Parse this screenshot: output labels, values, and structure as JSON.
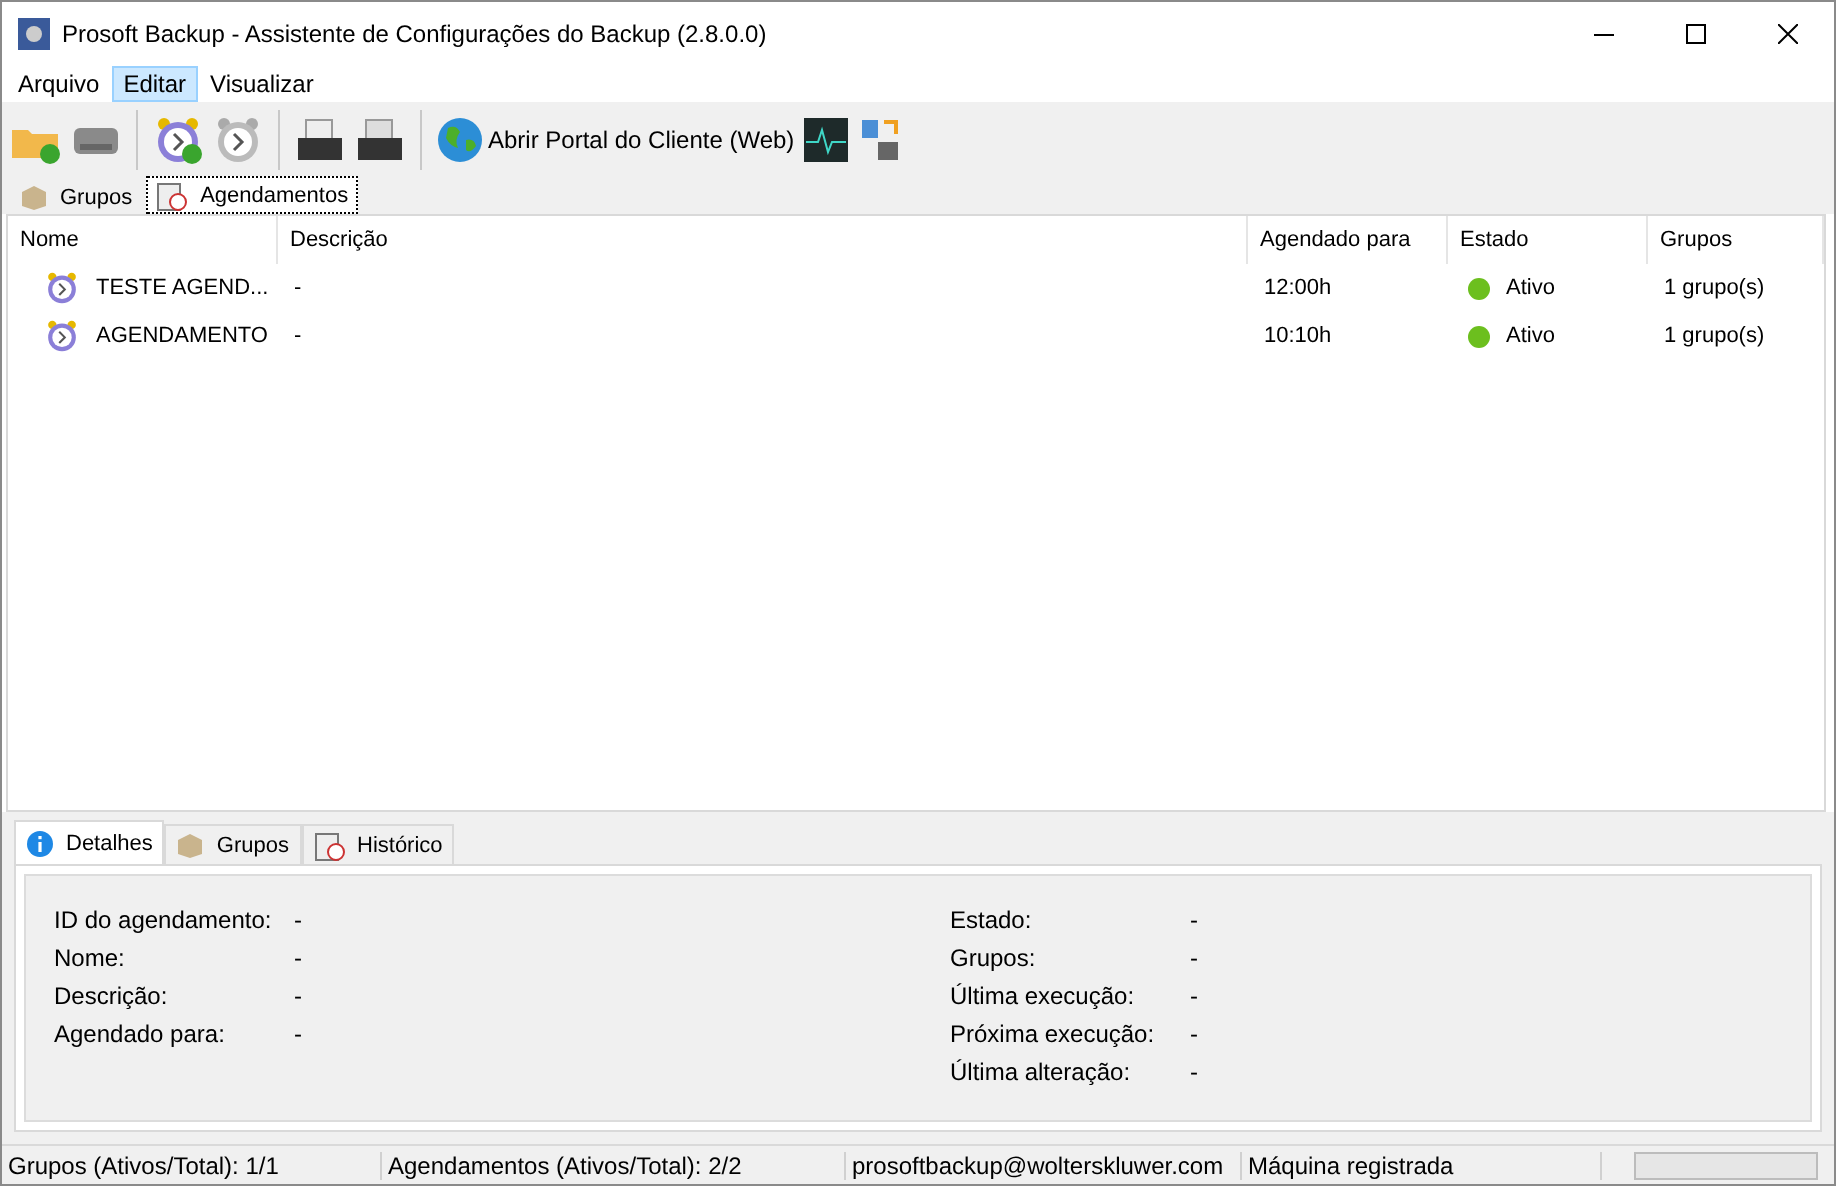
{
  "window": {
    "title": "Prosoft Backup - Assistente de Configurações do Backup (2.8.0.0)"
  },
  "menu": [
    {
      "label": "Arquivo",
      "selected": false
    },
    {
      "label": "Editar",
      "selected": true
    },
    {
      "label": "Visualizar",
      "selected": false
    }
  ],
  "toolbar": [
    {
      "kind": "icon"
    },
    {
      "kind": "icon"
    },
    {
      "kind": "separator"
    },
    {
      "kind": "icon"
    },
    {
      "kind": "icon"
    },
    {
      "kind": "separator"
    },
    {
      "kind": "icon"
    },
    {
      "kind": "icon"
    },
    {
      "kind": "separator"
    },
    {
      "kind": "labeled",
      "label": "Abrir Portal do Cliente (Web)"
    },
    {
      "kind": "icon"
    },
    {
      "kind": "icon"
    }
  ],
  "tabs": [
    {
      "label": "Grupos",
      "selected": false
    },
    {
      "label": "Agendamentos",
      "selected": true
    }
  ],
  "table": {
    "columns": [
      "Nome",
      "Descrição",
      "Agendado para",
      "Estado",
      "Grupos"
    ],
    "rows": [
      {
        "name": "TESTE AGEND...",
        "description": "-",
        "scheduled": "12:00h",
        "status": "Ativo",
        "color": "#6cbf1e",
        "groups": "1 grupo(s)"
      },
      {
        "name": "AGENDAMENTO",
        "description": "-",
        "scheduled": "10:10h",
        "status": "Ativo",
        "color": "#6cbf1e",
        "groups": "1 grupo(s)"
      }
    ]
  },
  "detail_tabs": [
    {
      "label": "Detalhes",
      "selected": true
    },
    {
      "label": "Grupos",
      "selected": false
    },
    {
      "label": "Histórico",
      "selected": false
    }
  ],
  "details": {
    "left": [
      {
        "label": "ID do agendamento:",
        "value": "-"
      },
      {
        "label": "Nome:",
        "value": "-"
      },
      {
        "label": "Descrição:",
        "value": "-"
      },
      {
        "label": "Agendado para:",
        "value": "-"
      }
    ],
    "right": [
      {
        "label": "Estado:",
        "value": "-"
      },
      {
        "label": "Grupos:",
        "value": "-"
      },
      {
        "label": "Última execução:",
        "value": "-"
      },
      {
        "label": "Próxima execução:",
        "value": "-"
      },
      {
        "label": "Última alteração:",
        "value": "-"
      }
    ]
  },
  "status_bar": {
    "texts": [
      "Grupos (Ativos/Total): 1/1",
      "Agendamentos (Ativos/Total): 2/2",
      "prosoftbackup@wolterskluwer.com",
      "Máquina registrada"
    ],
    "progress": {
      "level": 0
    }
  }
}
